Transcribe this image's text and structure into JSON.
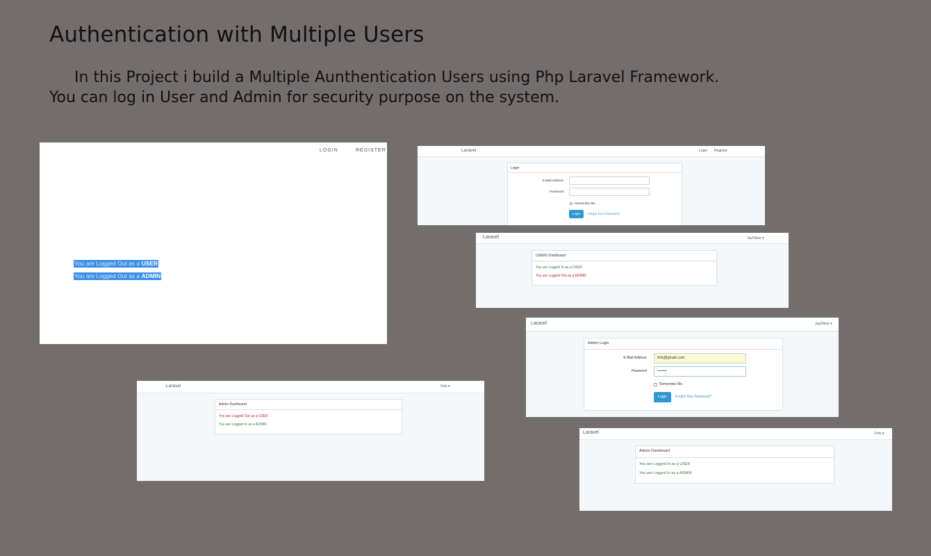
{
  "heading": "Authentication with Multiple Users",
  "description": {
    "line1": "In this Project i build a Multiple Aunthentication Users using Php Laravel Framework.",
    "line2": "You can log in User and Admin for security purpose on the system."
  },
  "shot_welcome": {
    "nav_login": "LOGIN",
    "nav_register": "REGISTER",
    "line_user_prefix": "You are Logged Out as a ",
    "line_user_role": "USER",
    "line_admin_prefix": "You are Logged Out as a ",
    "line_admin_role": "ADMIN"
  },
  "shot_login": {
    "brand": "Laravel",
    "nav_login": "Login",
    "nav_register": "Register",
    "panel_title": "Login",
    "email_label": "E-Mail Address",
    "password_label": "Password",
    "remember_label": "Remember Me",
    "login_button": "Login",
    "forgot_link": "Forgot Your Password?"
  },
  "shot_user_dashboard": {
    "brand": "Laravel",
    "user_menu": "JayOliver ▾",
    "panel_title": "USERS Dashboard",
    "line1_prefix": "You are Logged In as a ",
    "line1_role": "USER",
    "line2_prefix": "You are Logged Out as a ",
    "line2_role": "ADMIN"
  },
  "shot_admin_login": {
    "brand": "Laravel",
    "user_menu": "JayOliver ▾",
    "panel_title": "Admin Login",
    "email_label": "E-Mail Address",
    "email_value": "fefs@gmail.com",
    "password_label": "Password",
    "password_value": "••••••••",
    "remember_label": "Remember Me",
    "login_button": "Login",
    "forgot_link": "Forgot Your Password?"
  },
  "shot_admin_dashboard_a": {
    "brand": "Laravel",
    "user_menu": "Fefs ▾",
    "panel_title": "Admin Dashboard",
    "line1_prefix": "You are Logged Out as a ",
    "line1_role": "USER",
    "line2_prefix": "You are Logged In as a ",
    "line2_role": "ADMIN"
  },
  "shot_admin_dashboard_b": {
    "brand": "Laravel",
    "user_menu": "Fefs ▾",
    "panel_title": "Admin Dashboard",
    "line1_prefix": "You are Logged In as a ",
    "line1_role": "USER",
    "line2_prefix": "You are Logged In as a ",
    "line2_role": "ADMIN"
  },
  "colors": {
    "background": "#736e6d",
    "highlight": "#3a8ee6",
    "button": "#3097d1",
    "logged_in_text": "#2f7a3a",
    "logged_out_text": "#b02a2a"
  }
}
